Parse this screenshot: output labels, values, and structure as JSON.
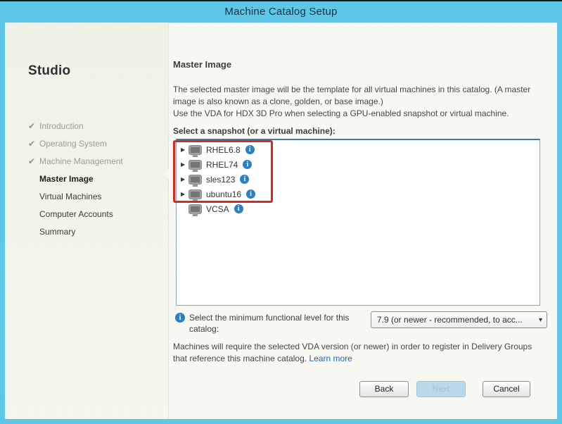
{
  "window": {
    "title": "Machine Catalog Setup"
  },
  "sidebar": {
    "brand": "Studio",
    "steps": [
      {
        "label": "Introduction",
        "status": "done"
      },
      {
        "label": "Operating System",
        "status": "done"
      },
      {
        "label": "Machine Management",
        "status": "done"
      },
      {
        "label": "Master Image",
        "status": "current"
      },
      {
        "label": "Virtual Machines",
        "status": "todo"
      },
      {
        "label": "Computer Accounts",
        "status": "todo"
      },
      {
        "label": "Summary",
        "status": "todo"
      }
    ],
    "check_glyph": "✔"
  },
  "main": {
    "heading": "Master Image",
    "intro_line1": "The selected master image will be the template for all virtual machines in this catalog. (A master image is also known as a clone, golden, or base image.)",
    "intro_line2": "Use the VDA for HDX 3D Pro when selecting a GPU-enabled snapshot or virtual machine.",
    "snapshot_label": "Select a snapshot (or a virtual machine):",
    "tree": {
      "items": [
        {
          "label": "RHEL6.8",
          "expandable": true,
          "highlighted": true
        },
        {
          "label": "RHEL74",
          "expandable": true,
          "highlighted": true
        },
        {
          "label": "sles123",
          "expandable": true,
          "highlighted": true
        },
        {
          "label": "ubuntu16",
          "expandable": true,
          "highlighted": true
        },
        {
          "label": "VCSA",
          "expandable": false,
          "highlighted": false
        }
      ],
      "expander_glyph": "▶",
      "info_glyph": "i"
    },
    "functional_level": {
      "label": "Select the minimum functional level for this catalog:",
      "selected_value": "7.9 (or newer - recommended, to acc...",
      "arrow_glyph": "▾"
    },
    "vda_note": "Machines will require the selected VDA version (or newer) in order to register in Delivery Groups that reference this machine catalog.",
    "learn_more_label": "Learn more"
  },
  "footer": {
    "back_label": "Back",
    "next_label": "Next",
    "cancel_label": "Cancel",
    "next_enabled": false
  },
  "colors": {
    "titlebar_blue": "#5ec7e8",
    "dialog_bg": "#f5f7ee",
    "highlight_red": "#d8291d",
    "info_blue": "#2b7fc3",
    "link_blue": "#2767ae",
    "next_disabled_bg": "#b9d8ea"
  }
}
